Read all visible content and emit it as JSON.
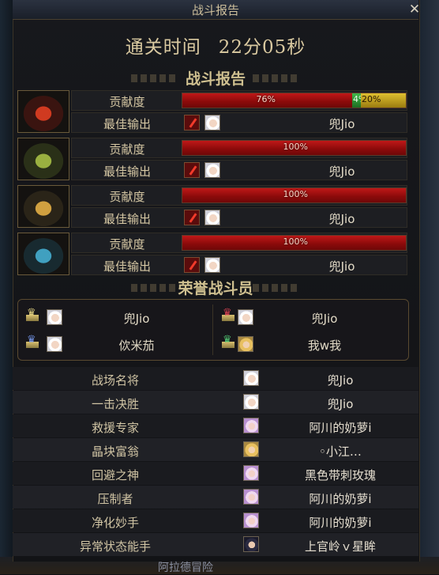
{
  "window": {
    "title": "战斗报告",
    "close": "✕"
  },
  "clear_time": {
    "label": "通关时间",
    "value": "22分05秒"
  },
  "section_battle": "战斗报告",
  "contribution_label": "贡献度",
  "best_output_label": "最佳输出",
  "players": [
    {
      "avatar": "red-flame-helmet-icon",
      "segments": [
        {
          "pct": 76,
          "label": "76%",
          "color": "#b01010"
        },
        {
          "pct": 4,
          "label": "4%",
          "color": "#2f9a3a"
        },
        {
          "pct": 20,
          "label": "20%",
          "color": "#c8a820"
        }
      ],
      "best_name": "兜Jio"
    },
    {
      "avatar": "green-wing-helmet-icon",
      "segments": [
        {
          "pct": 100,
          "label": "100%",
          "color": "#b01010"
        }
      ],
      "best_name": "兜Jio"
    },
    {
      "avatar": "gold-horn-helmet-icon",
      "segments": [
        {
          "pct": 100,
          "label": "100%",
          "color": "#b01010"
        }
      ],
      "best_name": "兜Jio"
    },
    {
      "avatar": "blue-crest-helmet-icon",
      "segments": [
        {
          "pct": 100,
          "label": "100%",
          "color": "#b01010"
        }
      ],
      "best_name": "兜Jio"
    }
  ],
  "section_honor": "荣誉战斗员",
  "honor": [
    {
      "name": "兜Jio",
      "crown": "gold-crown-icon"
    },
    {
      "name": "兜Jio",
      "crown": "red-crown-icon"
    },
    {
      "name": "佽米茄",
      "crown": "blue-crown-icon"
    },
    {
      "name": "我w我",
      "crown": "green-crown-icon"
    }
  ],
  "stats": [
    {
      "label": "战场名将",
      "name": "兜Jio"
    },
    {
      "label": "一击决胜",
      "name": "兜Jio"
    },
    {
      "label": "救援专家",
      "name": "阿川的奶萝i"
    },
    {
      "label": "晶块富翁",
      "name": "◦小江…"
    },
    {
      "label": "回避之神",
      "name": "黑色带刺玫瑰"
    },
    {
      "label": "压制者",
      "name": "阿川的奶萝i"
    },
    {
      "label": "净化妙手",
      "name": "阿川的奶萝i"
    },
    {
      "label": "异常状态能手",
      "name": "上官岭ｖ星眸"
    }
  ],
  "bottom_text": "阿拉德冒险"
}
